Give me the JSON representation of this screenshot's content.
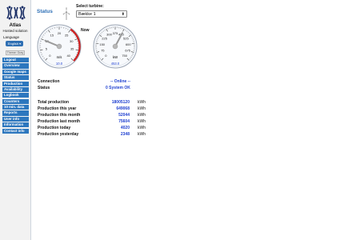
{
  "sidebar": {
    "brand_name": "Atlas",
    "brand_sub": "Hosted solution",
    "language_label": "Language",
    "language_value": "English",
    "theme_value": "Theme: Gray",
    "nav": [
      "Logout",
      "Overview",
      "Google maps",
      "Status",
      "Production",
      "Availability",
      "Logbook",
      "Counters",
      "10 min. data",
      "Reports",
      "User info",
      "Information",
      "Contact info"
    ]
  },
  "header": {
    "title": "Status",
    "select_label": "Select turbine:",
    "select_value": "Bække 1"
  },
  "gauges": {
    "now_label": "Now",
    "wind": {
      "unit": "m/s",
      "value": 10.0,
      "value_text": "10.0",
      "ticks": [
        "0",
        "5",
        "10",
        "15",
        "20",
        "25",
        "30",
        "35",
        "40"
      ]
    },
    "power": {
      "unit": "kW",
      "value": 453,
      "value_text": "453.0",
      "ticks": [
        "0",
        "75",
        "150",
        "225",
        "300",
        "375",
        "450",
        "525",
        "600",
        "675",
        "750"
      ]
    }
  },
  "status": {
    "connection_label": "Connection",
    "connection_value": "-- Online --",
    "status_label": "Status",
    "status_value": "0 System OK"
  },
  "production": {
    "unit": "kWh",
    "rows": [
      {
        "label": "Total production",
        "value": "18005120"
      },
      {
        "label": "Production this year",
        "value": "649068"
      },
      {
        "label": "Production this month",
        "value": "52044"
      },
      {
        "label": "Production last month",
        "value": "75604"
      },
      {
        "label": "Production today",
        "value": "4020"
      },
      {
        "label": "Production yesterday",
        "value": "2348"
      }
    ]
  },
  "colors": {
    "accent": "#2d77be",
    "value_blue": "#1e3fd0",
    "red_zone": "#d02020"
  }
}
